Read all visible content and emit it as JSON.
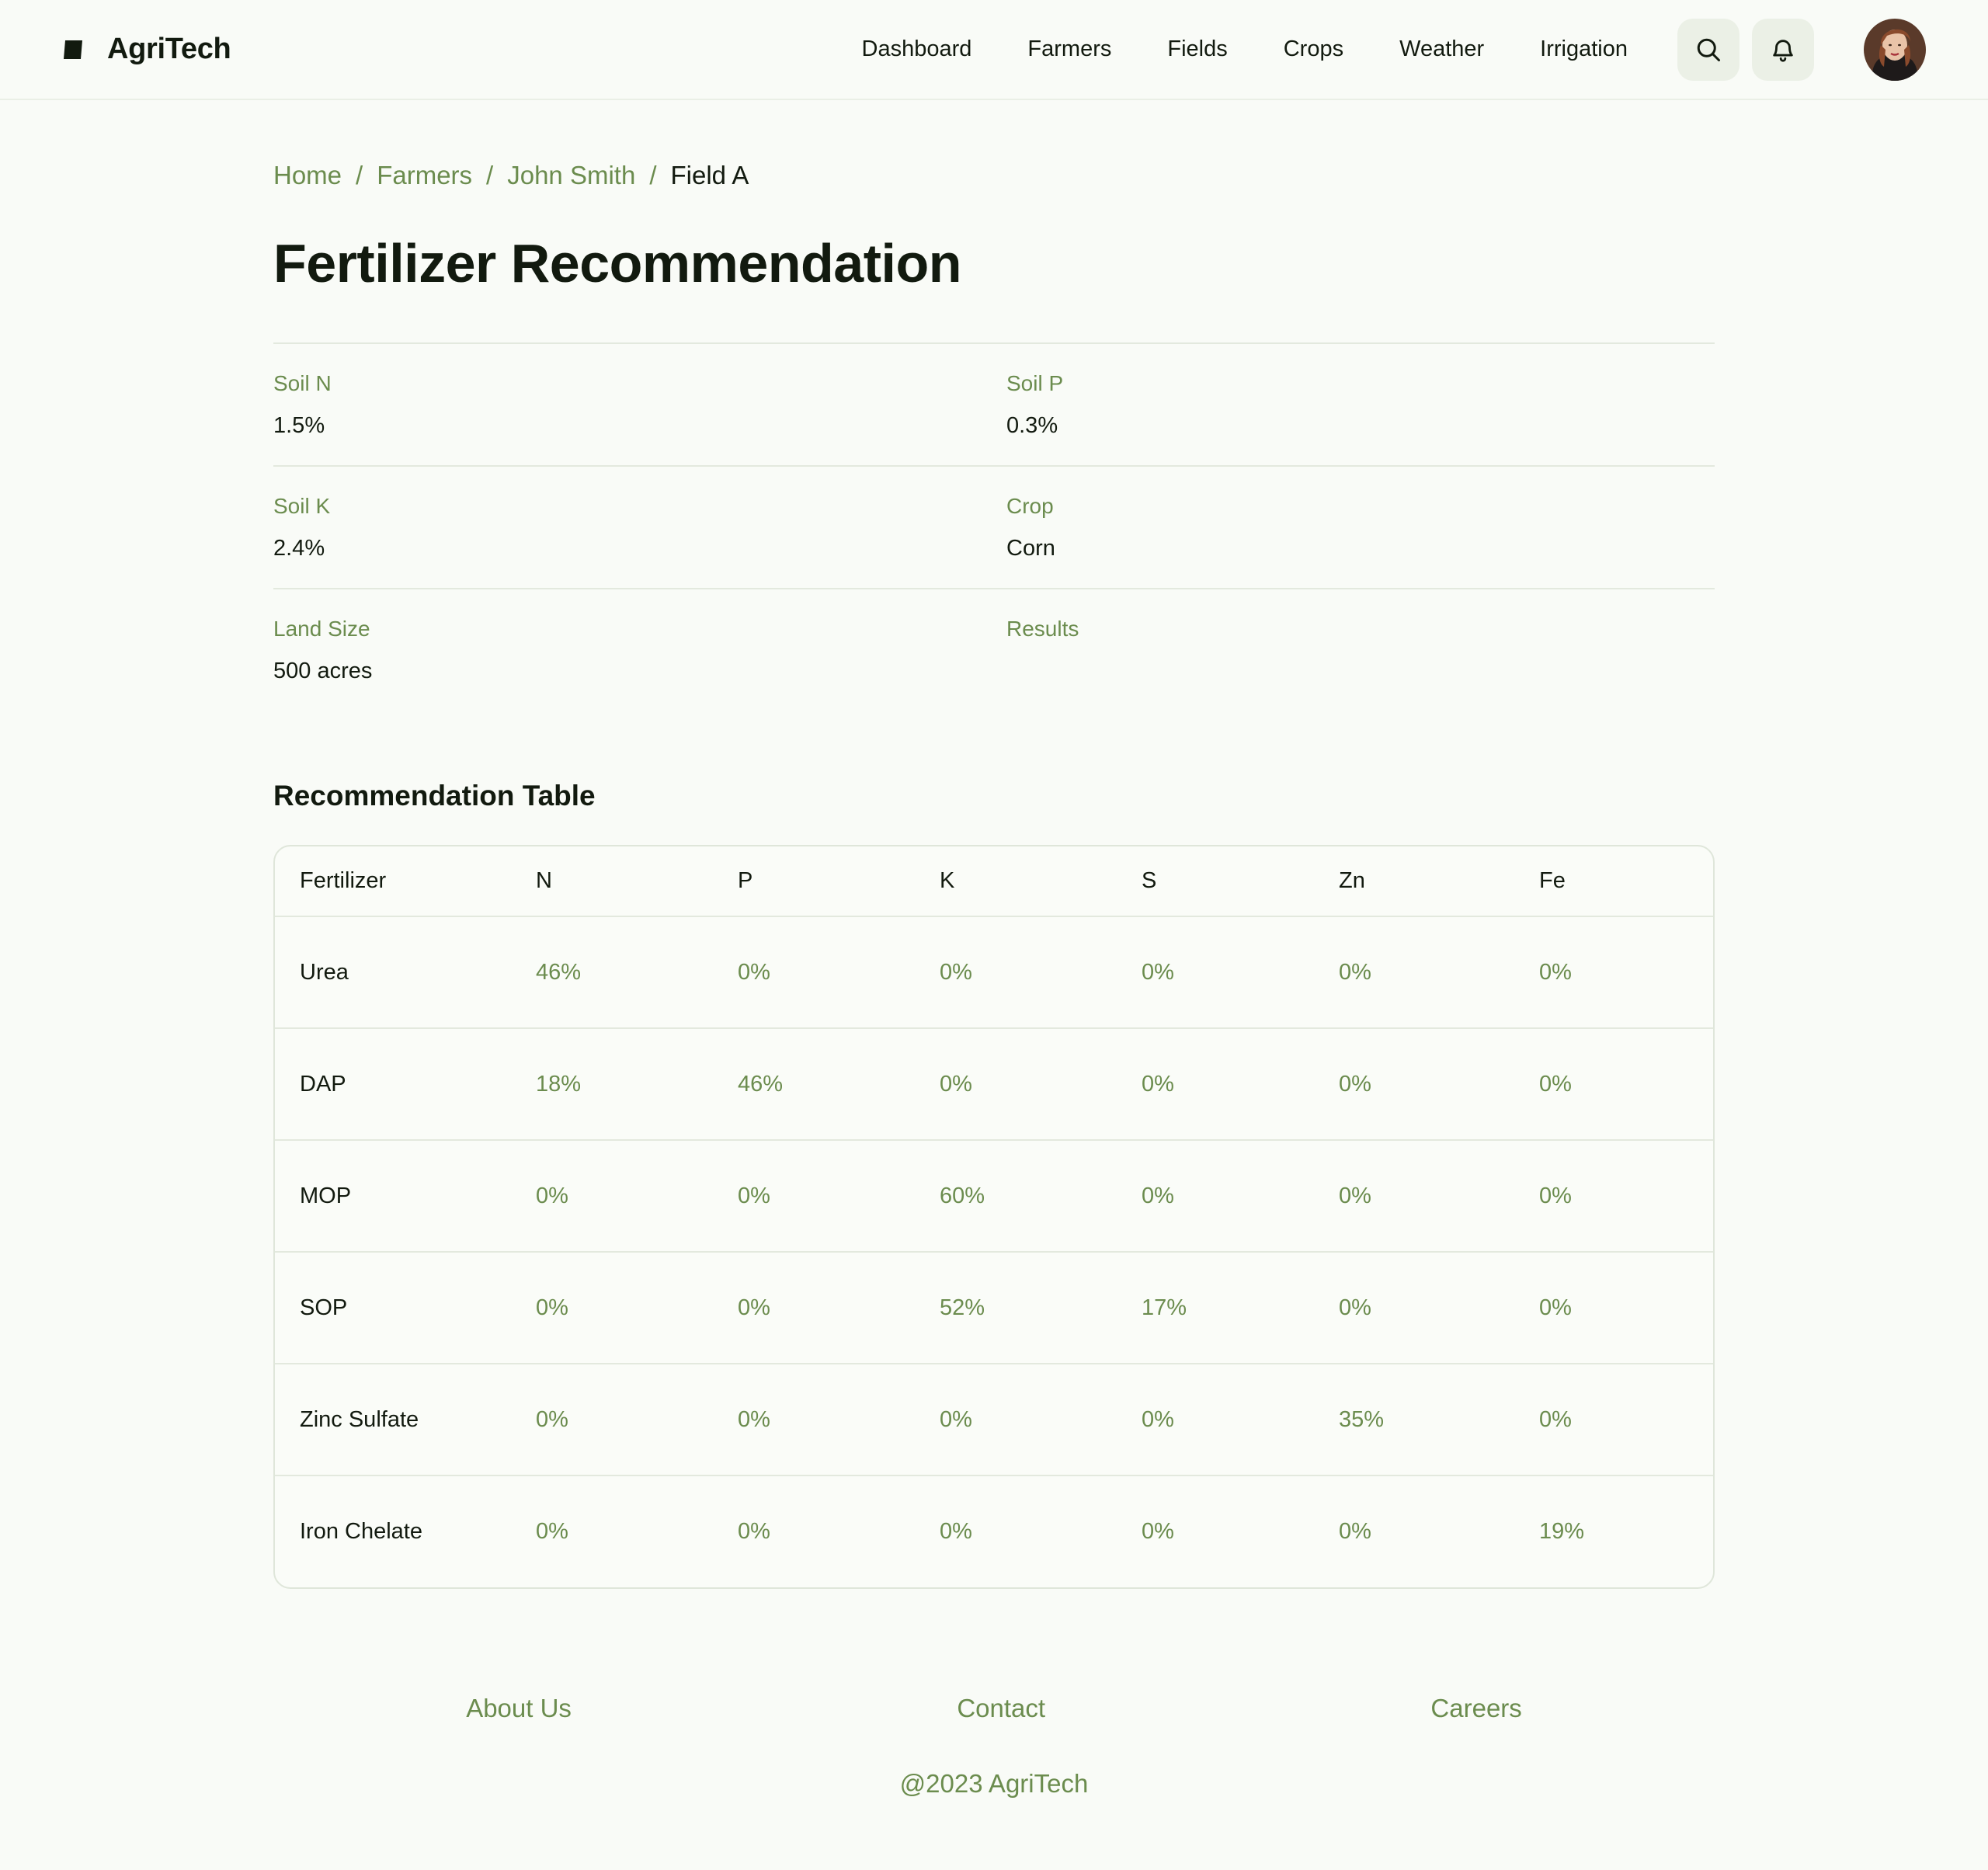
{
  "header": {
    "brand": "AgriTech",
    "nav": [
      "Dashboard",
      "Farmers",
      "Fields",
      "Crops",
      "Weather",
      "Irrigation"
    ],
    "icons": [
      "search-icon",
      "bell-icon"
    ]
  },
  "breadcrumb": {
    "items": [
      "Home",
      "Farmers",
      "John Smith"
    ],
    "current": "Field A",
    "separator": "/"
  },
  "page": {
    "title": "Fertilizer Recommendation"
  },
  "details": {
    "soil_n": {
      "label": "Soil N",
      "value": "1.5%"
    },
    "soil_p": {
      "label": "Soil P",
      "value": "0.3%"
    },
    "soil_k": {
      "label": "Soil K",
      "value": "2.4%"
    },
    "crop": {
      "label": "Crop",
      "value": "Corn"
    },
    "land_size": {
      "label": "Land Size",
      "value": "500 acres"
    },
    "results": {
      "label": "Results",
      "value": ""
    }
  },
  "recommendation": {
    "title": "Recommendation Table",
    "columns": [
      "Fertilizer",
      "N",
      "P",
      "K",
      "S",
      "Zn",
      "Fe"
    ],
    "rows": [
      [
        "Urea",
        "46%",
        "0%",
        "0%",
        "0%",
        "0%",
        "0%"
      ],
      [
        "DAP",
        "18%",
        "46%",
        "0%",
        "0%",
        "0%",
        "0%"
      ],
      [
        "MOP",
        "0%",
        "0%",
        "60%",
        "0%",
        "0%",
        "0%"
      ],
      [
        "SOP",
        "0%",
        "0%",
        "52%",
        "17%",
        "0%",
        "0%"
      ],
      [
        "Zinc Sulfate",
        "0%",
        "0%",
        "0%",
        "0%",
        "35%",
        "0%"
      ],
      [
        "Iron Chelate",
        "0%",
        "0%",
        "0%",
        "0%",
        "0%",
        "19%"
      ]
    ]
  },
  "footer": {
    "links": [
      "About Us",
      "Contact",
      "Careers"
    ],
    "copyright": "@2023 AgriTech"
  },
  "colors": {
    "accent": "#6b8c4e",
    "background": "#f9fbf7",
    "text": "#121a0f",
    "icon_button_bg": "#ebf0e6"
  }
}
